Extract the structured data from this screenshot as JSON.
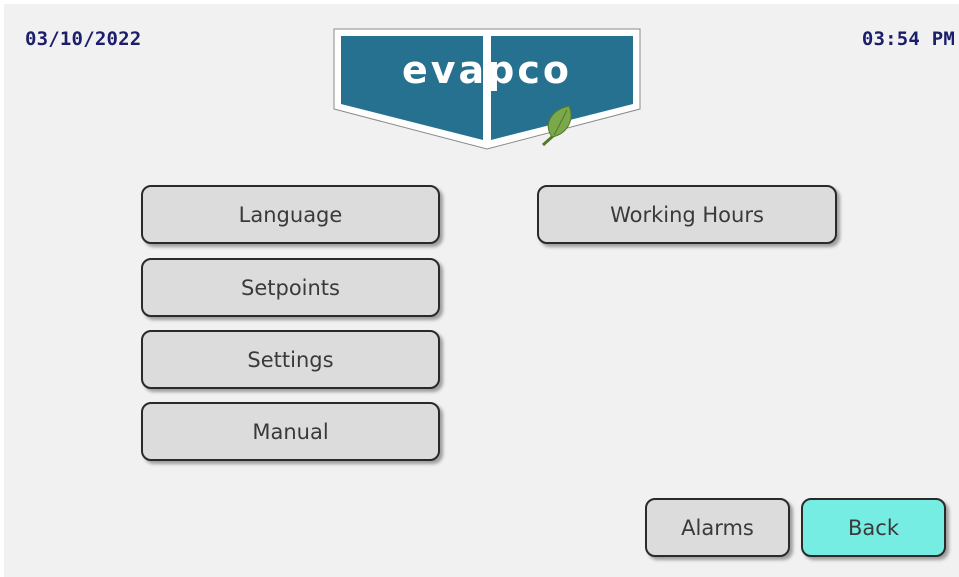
{
  "header": {
    "date": "03/10/2022",
    "time": "03:54 PM",
    "logo_text": "evapco"
  },
  "menu": {
    "language": "Language",
    "setpoints": "Setpoints",
    "settings": "Settings",
    "manual": "Manual",
    "working_hours": "Working Hours"
  },
  "footer": {
    "alarms": "Alarms",
    "back": "Back"
  },
  "colors": {
    "background": "#f1f1f1",
    "header_text": "#1b1f6b",
    "button_face": "#dcdcdc",
    "back_button": "#76ede3",
    "logo_blue": "#26718f",
    "leaf_green": "#7aa84a"
  },
  "icons": {
    "logo": "evapco-shield-logo",
    "leaf": "leaf-icon"
  }
}
